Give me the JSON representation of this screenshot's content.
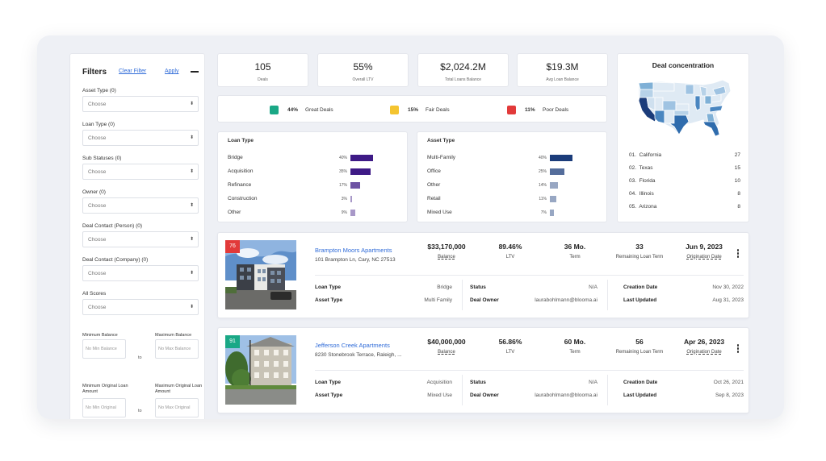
{
  "filters": {
    "title": "Filters",
    "clear_label": "Clear Filter",
    "apply_label": "Apply",
    "fields": [
      {
        "label": "Asset Type (0)",
        "value": "Choose"
      },
      {
        "label": "Loan Type (0)",
        "value": "Choose"
      },
      {
        "label": "Sub Statuses (0)",
        "value": "Choose"
      },
      {
        "label": "Owner (0)",
        "value": "Choose"
      },
      {
        "label": "Deal Contact (Person) (0)",
        "value": "Choose"
      },
      {
        "label": "Deal Contact (Company) (0)",
        "value": "Choose"
      },
      {
        "label": "All Scores",
        "value": "Choose"
      }
    ],
    "min_balance_label": "Minimum Balance",
    "max_balance_label": "Maximum Balance",
    "min_balance_placeholder": "No Min Balance",
    "max_balance_placeholder": "No Max Balance",
    "min_orig_label": "Minimum Original Loan Amount",
    "max_orig_label": "Maximum Original Loan Amount",
    "min_orig_placeholder": "No Min Original",
    "max_orig_placeholder": "No Max Original",
    "to_label": "to"
  },
  "kpis": [
    {
      "value": "105",
      "label": "Deals"
    },
    {
      "value": "55%",
      "label": "Overall LTV"
    },
    {
      "value": "$2,024.2M",
      "label": "Total Loans Balance"
    },
    {
      "value": "$19.3M",
      "label": "Avg Loan Balance"
    }
  ],
  "quality": [
    {
      "pct": "44%",
      "name": "Great Deals",
      "color": "#1aa886"
    },
    {
      "pct": "15%",
      "name": "Fair Deals",
      "color": "#f4c430"
    },
    {
      "pct": "11%",
      "name": "Poor Deals",
      "color": "#e23a3a"
    }
  ],
  "loan_type": {
    "title": "Loan Type",
    "color": "#3e1a86",
    "rows": [
      {
        "name": "Bridge",
        "pct": "40%",
        "value": 40
      },
      {
        "name": "Acquisition",
        "pct": "35%",
        "value": 35
      },
      {
        "name": "Refinance",
        "pct": "17%",
        "value": 17
      },
      {
        "name": "Construction",
        "pct": "3%",
        "value": 3
      },
      {
        "name": "Other",
        "pct": "9%",
        "value": 9
      }
    ]
  },
  "asset_type": {
    "title": "Asset Type",
    "color": "#1b3c7a",
    "rows": [
      {
        "name": "Multi-Family",
        "pct": "40%",
        "value": 40
      },
      {
        "name": "Office",
        "pct": "25%",
        "value": 25
      },
      {
        "name": "Other",
        "pct": "14%",
        "value": 14
      },
      {
        "name": "Retail",
        "pct": "11%",
        "value": 11
      },
      {
        "name": "Mixed Use",
        "pct": "7%",
        "value": 7
      }
    ]
  },
  "concentration": {
    "title": "Deal concentration",
    "rows": [
      {
        "rank": "01.",
        "state": "California",
        "count": "27"
      },
      {
        "rank": "02.",
        "state": "Texas",
        "count": "15"
      },
      {
        "rank": "03.",
        "state": "Florida",
        "count": "10"
      },
      {
        "rank": "04.",
        "state": "Illinois",
        "count": "8"
      },
      {
        "rank": "05.",
        "state": "Arizona",
        "count": "8"
      }
    ]
  },
  "deals": [
    {
      "score": "76",
      "score_color": "#e23a3a",
      "name": "Brampton Moors Apartments",
      "address": "101 Brampton Ln, Cary, NC 27513",
      "balance": "$33,170,000",
      "balance_label": "Balance",
      "ltv": "89.46%",
      "ltv_label": "LTV",
      "term": "36 Mo.",
      "term_label": "Term",
      "remaining": "33",
      "remaining_label": "Remaining Loan Term",
      "orig_date": "Jun 9, 2023",
      "orig_label": "Origination Date",
      "loan_type_label": "Loan Type",
      "loan_type": "Bridge",
      "asset_type_label": "Asset Type",
      "asset_type": "Multi Family",
      "status_label": "Status",
      "status": "N/A",
      "owner_label": "Deal Owner",
      "owner": "laurabohlmann@blooma.ai",
      "created_label": "Creation Date",
      "created": "Nov 30, 2022",
      "updated_label": "Last Updated",
      "updated": "Aug 31, 2023"
    },
    {
      "score": "91",
      "score_color": "#1aa886",
      "name": "Jefferson Creek Apartments",
      "address": "8230 Stonebrook Terrace, Raleigh, ...",
      "balance": "$40,000,000",
      "balance_label": "Balance",
      "ltv": "56.86%",
      "ltv_label": "LTV",
      "term": "60 Mo.",
      "term_label": "Term",
      "remaining": "56",
      "remaining_label": "Remaining Loan Term",
      "orig_date": "Apr 26, 2023",
      "orig_label": "Origination Date",
      "loan_type_label": "Loan Type",
      "loan_type": "Acquisition",
      "asset_type_label": "Asset Type",
      "asset_type": "Mixed Use",
      "status_label": "Status",
      "status": "N/A",
      "owner_label": "Deal Owner",
      "owner": "laurabohlmann@blooma.ai",
      "created_label": "Creation Date",
      "created": "Oct 26, 2021",
      "updated_label": "Last Updated",
      "updated": "Sep 8, 2023"
    }
  ]
}
